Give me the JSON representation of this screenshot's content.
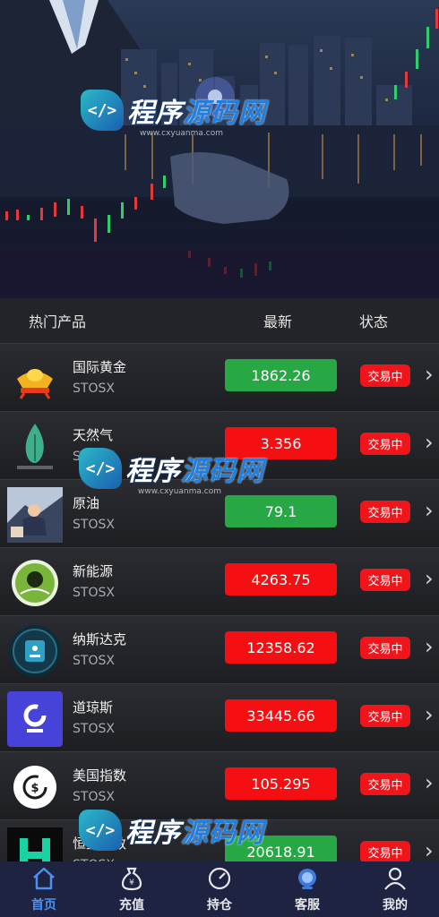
{
  "watermark": {
    "brand_a": "程序",
    "brand_b": "源码网",
    "badge": "</>",
    "url": "www.cxyuanma.com"
  },
  "list_header": {
    "products": "热门产品",
    "latest": "最新",
    "status": "状态"
  },
  "rows": [
    {
      "name": "国际黄金",
      "code": "STOSX",
      "price": "1862.26",
      "trend": "up",
      "status": "交易中",
      "logo": "gold-ingot-icon"
    },
    {
      "name": "天然气",
      "code": "STOSX",
      "price": "3.356",
      "trend": "down",
      "status": "交易中",
      "logo": "natural-gas-flame-icon"
    },
    {
      "name": "原油",
      "code": "STOSX",
      "price": "79.1",
      "trend": "up",
      "status": "交易中",
      "logo": "crude-oil-photo"
    },
    {
      "name": "新能源",
      "code": "STOSX",
      "price": "4263.75",
      "trend": "down",
      "status": "交易中",
      "logo": "new-energy-icon"
    },
    {
      "name": "纳斯达克",
      "code": "STOSX",
      "price": "12358.62",
      "trend": "down",
      "status": "交易中",
      "logo": "nasdaq-icon"
    },
    {
      "name": "道琼斯",
      "code": "STOSX",
      "price": "33445.66",
      "trend": "down",
      "status": "交易中",
      "logo": "dow-jones-icon"
    },
    {
      "name": "美国指数",
      "code": "STOSX",
      "price": "105.295",
      "trend": "down",
      "status": "交易中",
      "logo": "us-index-icon"
    },
    {
      "name": "恒生指数",
      "code": "STOSX",
      "price": "20618.91",
      "trend": "up",
      "status": "交易中",
      "logo": "hang-seng-icon"
    }
  ],
  "tabs": [
    {
      "label": "首页",
      "icon": "home-icon",
      "active": true
    },
    {
      "label": "充值",
      "icon": "money-bag-icon",
      "active": false
    },
    {
      "label": "持仓",
      "icon": "gauge-icon",
      "active": false
    },
    {
      "label": "客服",
      "icon": "support-icon",
      "active": false
    },
    {
      "label": "我的",
      "icon": "user-icon",
      "active": false
    }
  ],
  "colors": {
    "up": "#27a844",
    "down": "#f50f12",
    "status_bg": "#f0141b",
    "tab_active": "#4d8ff0",
    "tabbar_bg": "#1d2341"
  }
}
